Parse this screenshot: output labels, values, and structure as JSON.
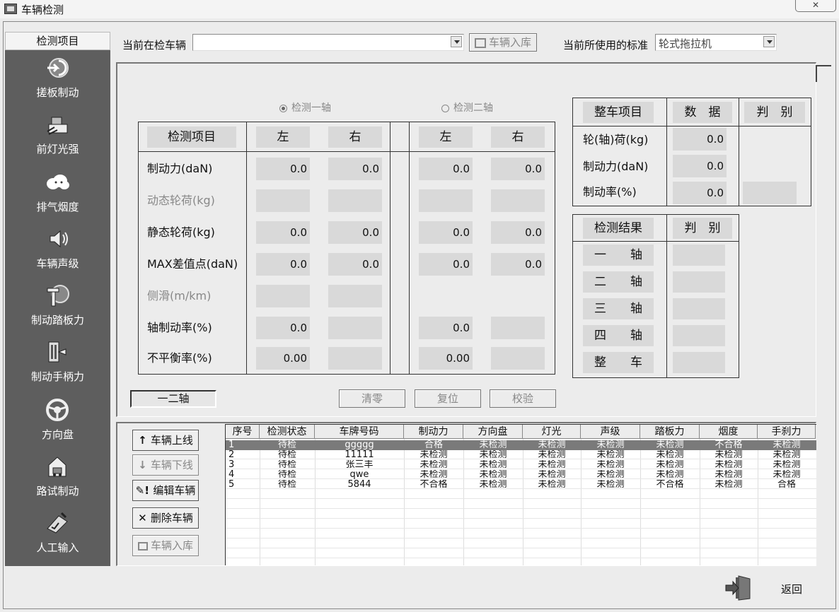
{
  "window": {
    "title": "车辆检测",
    "close_glyph": "✕"
  },
  "sidebar": {
    "header": "检测项目",
    "items": [
      {
        "label": "搓板制动",
        "icon": "brake-plate-icon"
      },
      {
        "label": "前灯光强",
        "icon": "headlight-icon"
      },
      {
        "label": "排气烟度",
        "icon": "exhaust-smoke-icon"
      },
      {
        "label": "车辆声级",
        "icon": "speaker-icon"
      },
      {
        "label": "制动踏板力",
        "icon": "brake-pedal-icon"
      },
      {
        "label": "制动手柄力",
        "icon": "hand-brake-icon"
      },
      {
        "label": "方向盘",
        "icon": "steering-wheel-icon"
      },
      {
        "label": "路试制动",
        "icon": "road-test-icon"
      },
      {
        "label": "人工输入",
        "icon": "manual-input-icon"
      }
    ]
  },
  "topbar": {
    "current_vehicle_label": "当前在检车辆",
    "current_vehicle_value": "",
    "store_button": "车辆入库",
    "standard_label": "当前所使用的标准",
    "standard_value": "轮式拖拉机"
  },
  "axle_options": {
    "axle1": "检测一轴",
    "axle2": "检测二轴",
    "selected": "axle1"
  },
  "test_table": {
    "header": {
      "item": "检测项目",
      "left": "左",
      "right": "右"
    },
    "rows": [
      {
        "label": "制动力(daN)",
        "dim": false,
        "a1l": "0.0",
        "a1r": "0.0",
        "a2l": "0.0",
        "a2r": "0.0"
      },
      {
        "label": "动态轮荷(kg)",
        "dim": true,
        "a1l": "",
        "a1r": "",
        "a2l": "",
        "a2r": ""
      },
      {
        "label": "静态轮荷(kg)",
        "dim": false,
        "a1l": "0.0",
        "a1r": "0.0",
        "a2l": "0.0",
        "a2r": "0.0"
      },
      {
        "label": "MAX差值点(daN)",
        "dim": false,
        "a1l": "0.0",
        "a1r": "0.0",
        "a2l": "0.0",
        "a2r": "0.0"
      },
      {
        "label": "侧滑(m/km)",
        "dim": true,
        "a1l": "",
        "a1r": "",
        "a2l": "",
        "a2r": ""
      },
      {
        "label": "轴制动率(%)",
        "dim": false,
        "a1l": "0.0",
        "a1r": "",
        "a2l": "0.0",
        "a2r": ""
      },
      {
        "label": "不平衡率(%)",
        "dim": false,
        "a1l": "0.00",
        "a1r": "",
        "a2l": "0.00",
        "a2r": ""
      }
    ]
  },
  "vehicle_summary": {
    "headers": [
      "整车项目",
      "数　据",
      "判　别"
    ],
    "rows": [
      {
        "label": "轮(轴)荷(kg)",
        "value": "0.0"
      },
      {
        "label": "制动力(daN)",
        "value": "0.0"
      },
      {
        "label": "制动率(%)",
        "value": "0.0"
      }
    ]
  },
  "result_table": {
    "headers": [
      "检测结果",
      "判　别"
    ],
    "rows": [
      "一　　轴",
      "二　　轴",
      "三　　轴",
      "四　　轴",
      "整　　车"
    ]
  },
  "axle_indicator": "一二轴",
  "panel_buttons": {
    "clear": "清零",
    "reset": "复位",
    "calibrate": "校验"
  },
  "list_buttons": {
    "online": "车辆上线",
    "offline": "车辆下线",
    "edit": "编辑车辆",
    "delete": "删除车辆",
    "store": "车辆入库"
  },
  "vehicle_grid": {
    "columns": [
      "序号",
      "检测状态",
      "车牌号码",
      "制动力",
      "方向盘",
      "灯光",
      "声级",
      "踏板力",
      "烟度",
      "手刹力"
    ],
    "rows": [
      [
        "1",
        "待检",
        "ggggg",
        "合格",
        "未检测",
        "未检测",
        "未检测",
        "未检测",
        "不合格",
        "未检测"
      ],
      [
        "2",
        "待检",
        "11111",
        "未检测",
        "未检测",
        "未检测",
        "未检测",
        "未检测",
        "未检测",
        "未检测"
      ],
      [
        "3",
        "待检",
        "张三丰",
        "未检测",
        "未检测",
        "未检测",
        "未检测",
        "未检测",
        "未检测",
        "未检测"
      ],
      [
        "4",
        "待检",
        "qwe",
        "未检测",
        "未检测",
        "未检测",
        "未检测",
        "未检测",
        "未检测",
        "未检测"
      ],
      [
        "5",
        "待检",
        "5844",
        "不合格",
        "未检测",
        "未检测",
        "未检测",
        "不合格",
        "未检测",
        "合格"
      ]
    ],
    "selected_row": 0,
    "selected_color": "#7a7a7a"
  },
  "footer": {
    "back_label": "返回"
  }
}
